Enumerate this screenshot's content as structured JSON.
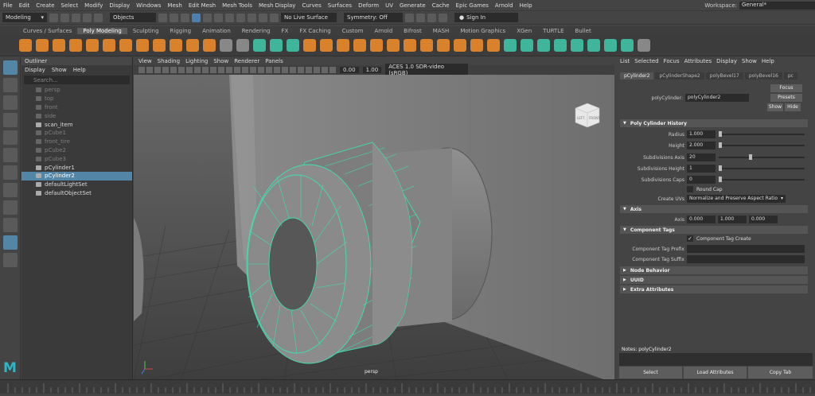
{
  "menubar": {
    "items": [
      "File",
      "Edit",
      "Create",
      "Select",
      "Modify",
      "Display",
      "Windows",
      "Mesh",
      "Edit Mesh",
      "Mesh Tools",
      "Mesh Display",
      "Curves",
      "Surfaces",
      "Deform",
      "UV",
      "Generate",
      "Cache",
      "Epic Games",
      "Arnold",
      "Help"
    ],
    "workspace_label": "Workspace:",
    "workspace_value": "General*"
  },
  "statusline": {
    "mode": "Modeling",
    "selection_mode": "Objects",
    "live_surface": "No Live Surface",
    "symmetry": "Symmetry: Off",
    "sign_in": "Sign In"
  },
  "shelf": {
    "tabs": [
      "Curves / Surfaces",
      "Poly Modeling",
      "Sculpting",
      "Rigging",
      "Animation",
      "Rendering",
      "FX",
      "FX Caching",
      "Custom",
      "Arnold",
      "Bifrost",
      "MASH",
      "Motion Graphics",
      "XGen",
      "TURTLE",
      "Bullet"
    ],
    "active_tab": 1
  },
  "outliner": {
    "title": "Outliner",
    "menu": [
      "Display",
      "Show",
      "Help"
    ],
    "search_placeholder": "Search...",
    "items": [
      {
        "label": "persp",
        "dim": true
      },
      {
        "label": "top",
        "dim": true
      },
      {
        "label": "front",
        "dim": true
      },
      {
        "label": "side",
        "dim": true
      },
      {
        "label": "scan_item",
        "dim": false
      },
      {
        "label": "pCube1",
        "dim": true
      },
      {
        "label": "front_tire",
        "dim": true
      },
      {
        "label": "pCube2",
        "dim": true
      },
      {
        "label": "pCube3",
        "dim": true
      },
      {
        "label": "pCylinder1",
        "dim": false
      },
      {
        "label": "pCylinder2",
        "dim": false,
        "selected": true
      },
      {
        "label": "defaultLightSet",
        "dim": false
      },
      {
        "label": "defaultObjectSet",
        "dim": false
      }
    ]
  },
  "viewport": {
    "menu": [
      "View",
      "Shading",
      "Lighting",
      "Show",
      "Renderer",
      "Panels"
    ],
    "exposure": "0.00",
    "gamma": "1.00",
    "color_space": "ACES 1.0 SDR-video (sRGB)",
    "camera_label": "persp",
    "cube_left": "LEFT",
    "cube_front": "FRONT"
  },
  "attr": {
    "menu": [
      "List",
      "Selected",
      "Focus",
      "Attributes",
      "Display",
      "Show",
      "Help"
    ],
    "tabs": [
      "pCylinder2",
      "pCylinderShape2",
      "polyBevel17",
      "polyBevel16",
      "pc"
    ],
    "node_label": "polyCylinder:",
    "node_name": "polyCylinder2",
    "focus": "Focus",
    "presets": "Presets",
    "show": "Show",
    "hide": "Hide",
    "history_title": "Poly Cylinder History",
    "radius_label": "Radius",
    "radius": "1.000",
    "height_label": "Height",
    "height": "2.000",
    "subdiv_axis_label": "Subdivisions Axis",
    "subdiv_axis": "20",
    "subdiv_height_label": "Subdivisions Height",
    "subdiv_height": "1",
    "subdiv_caps_label": "Subdivisions Caps",
    "subdiv_caps": "0",
    "round_cap": "Round Cap",
    "create_uvs_label": "Create UVs",
    "create_uvs": "Normalize and Preserve Aspect Ratio",
    "axis_title": "Axis",
    "axis_label": "Axis",
    "axis_values": [
      "0.000",
      "1.000",
      "0.000"
    ],
    "tags_title": "Component Tags",
    "tag_create": "Component Tag Create",
    "tag_prefix": "Component Tag Prefix",
    "tag_suffix": "Component Tag Suffix",
    "node_behavior": "Node Behavior",
    "uuid": "UUID",
    "extra": "Extra Attributes",
    "notes": "Notes:  polyCylinder2",
    "btn_select": "Select",
    "btn_load": "Load Attributes",
    "btn_copy": "Copy Tab"
  },
  "colors": {
    "selection_blue": "#5285a6",
    "wireframe_teal": "#3ee0b0",
    "maya_logo": "#2fb6c5"
  }
}
